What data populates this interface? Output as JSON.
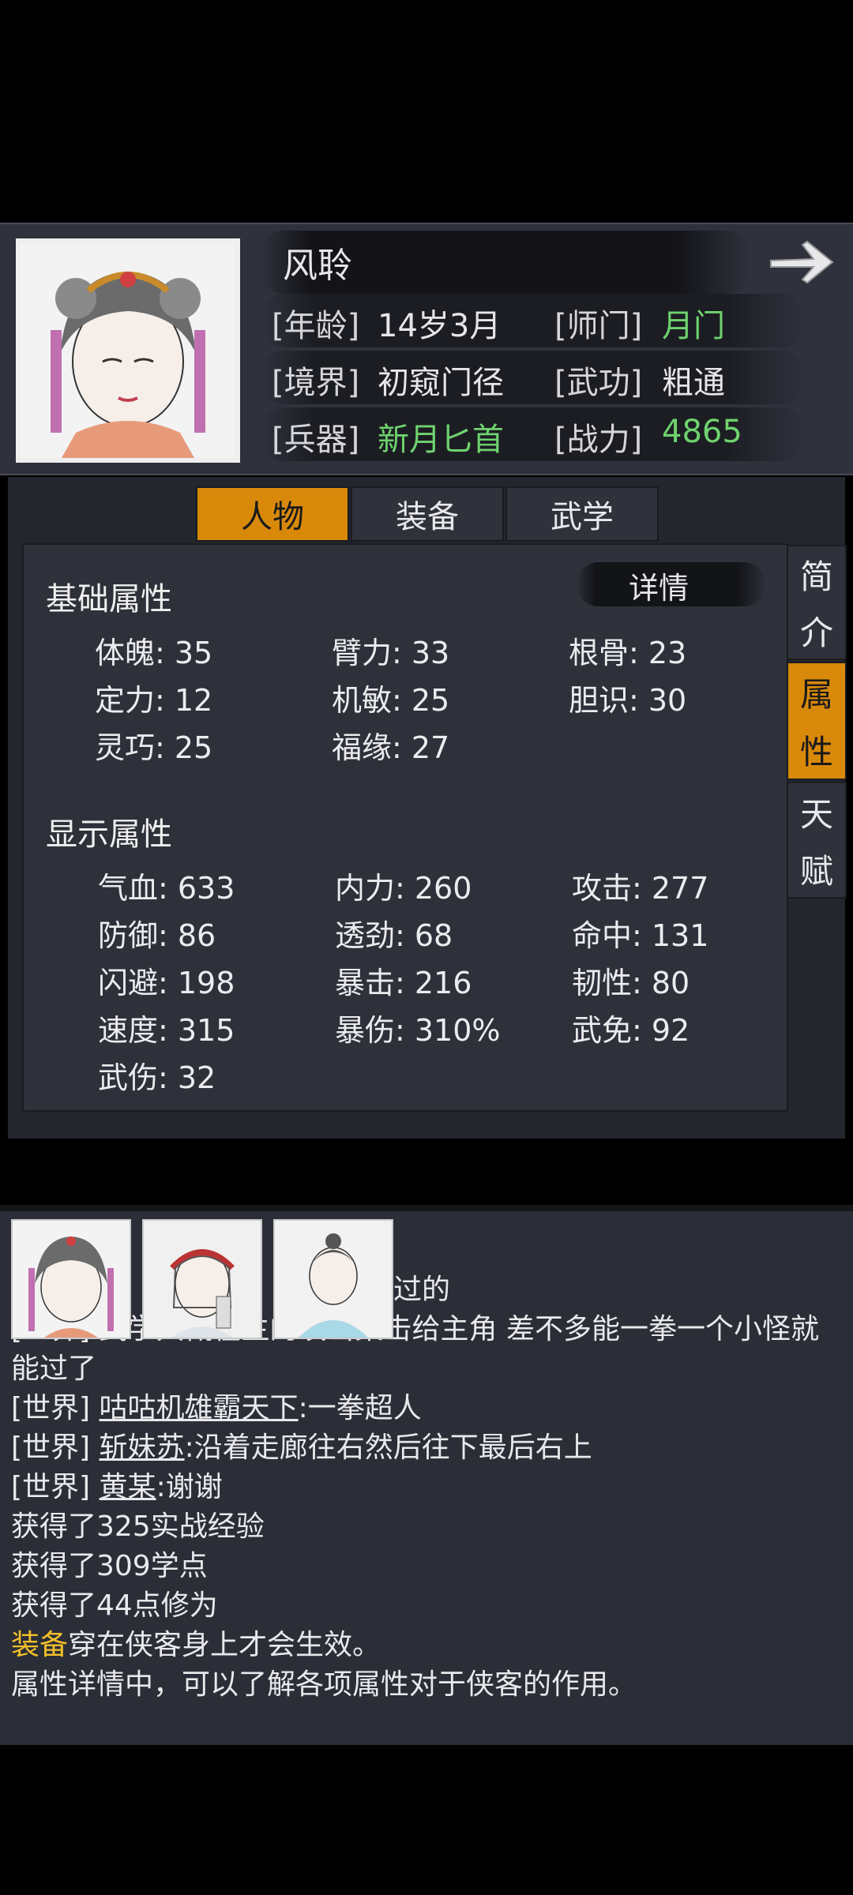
{
  "character": {
    "name": "风聆",
    "age_label": "[年龄]",
    "age": "14岁3月",
    "sect_label": "[师门]",
    "sect": "月门",
    "realm_label": "[境界]",
    "realm": "初窥门径",
    "martial_label": "[武功]",
    "martial": "粗通",
    "weapon_label": "[兵器]",
    "weapon": "新月匕首",
    "power_label": "[战力]",
    "power": "4865"
  },
  "tabs": [
    "人物",
    "装备",
    "武学"
  ],
  "side_tabs": [
    {
      "chars": [
        "简",
        "介"
      ]
    },
    {
      "chars": [
        "属",
        "性"
      ]
    },
    {
      "chars": [
        "天",
        "赋"
      ]
    }
  ],
  "details_label": "详情",
  "basic": {
    "title": "基础属性",
    "stats": [
      "体魄: 35",
      "臂力: 33",
      "根骨: 23",
      "定力: 12",
      "机敏: 25",
      "胆识: 30",
      "灵巧: 25",
      "福缘: 27"
    ]
  },
  "display": {
    "title": "显示属性",
    "stats": [
      "气血: 633",
      "内力: 260",
      "攻击: 277",
      "防御: 86",
      "透劲: 68",
      "命中: 131",
      "闪避: 198",
      "暴击: 216",
      "韧性: 80",
      "速度: 315",
      "暴伤: 310%",
      "武免: 92",
      "武伤: 32"
    ]
  },
  "chat": {
    "partial_line1": "过的",
    "partial_line2": "[世界] 武学大概在主的攻击集击给主角 差不多能一拳一个小怪就",
    "partial_line3": "能过了",
    "lines": [
      {
        "channel": "[世界]",
        "user": "咕咕机雄霸天下",
        "text": ":一拳超人"
      },
      {
        "channel": "[世界]",
        "user": "斩妹苏",
        "text": ":沿着走廊往右然后往下最后右上"
      },
      {
        "channel": "[世界]",
        "user": "黄某",
        "text": ":谢谢"
      }
    ],
    "system": [
      "获得了325实战经验",
      "获得了309学点",
      "获得了44点修为"
    ],
    "tip1_highlight": "装备",
    "tip1_rest": "穿在侠客身上才会生效。",
    "tip2": "属性详情中，可以了解各项属性对于侠客的作用。"
  },
  "colors": {
    "accent": "#d9890a",
    "green": "#6fd36f",
    "gold": "#f4bf2a"
  }
}
